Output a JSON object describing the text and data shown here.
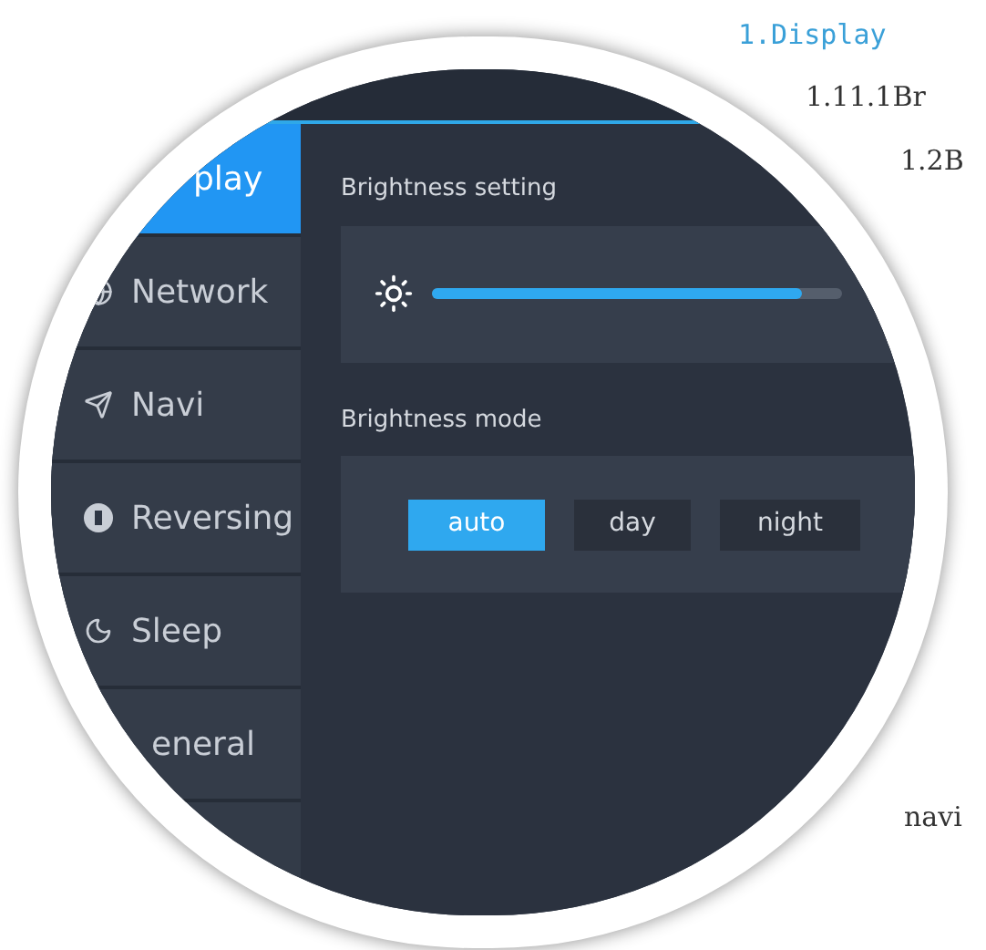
{
  "document": {
    "heading": "1.Display",
    "lines": [
      "1.11.1Br",
      "1.2B",
      "navi"
    ]
  },
  "sidebar": {
    "items": [
      {
        "label": "play",
        "selected": true
      },
      {
        "label": "Network",
        "selected": false
      },
      {
        "label": "Navi",
        "selected": false
      },
      {
        "label": "Reversing",
        "selected": false
      },
      {
        "label": "Sleep",
        "selected": false
      },
      {
        "label": "eneral",
        "selected": false
      }
    ]
  },
  "brightness_setting": {
    "label": "Brightness setting",
    "level": 0.9
  },
  "brightness_mode": {
    "label": "Brightness mode",
    "options": [
      {
        "label": "auto",
        "selected": true
      },
      {
        "label": "day",
        "selected": false
      },
      {
        "label": "night",
        "selected": false
      }
    ]
  }
}
